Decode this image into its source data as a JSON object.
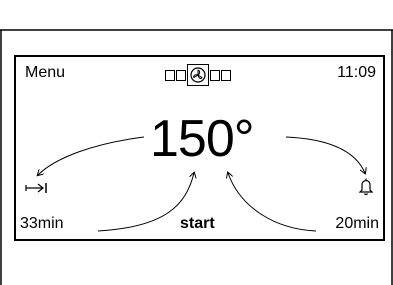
{
  "display": {
    "menu_label": "Menu",
    "clock": "11:09",
    "temperature": "150°",
    "duration": "33min",
    "start_label": "start",
    "end_time": "20min"
  },
  "icons": {
    "mode_selected": "fan-icon",
    "duration": "duration-arrow-icon",
    "end": "bell-icon"
  }
}
